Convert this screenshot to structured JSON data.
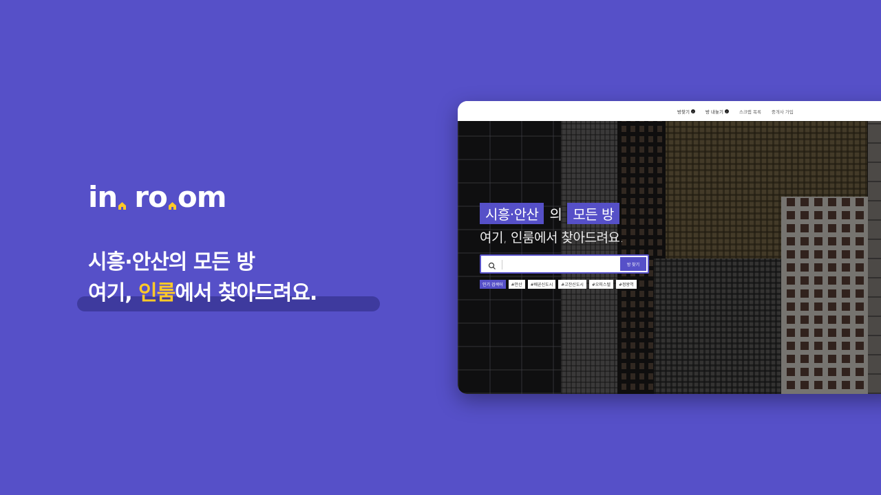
{
  "brand": {
    "logo_part1": "in",
    "logo_part2": "ro",
    "logo_part3": "om",
    "headline_line1": "시흥·안산의 모든 방",
    "headline_line2_pre": "여기, ",
    "headline_line2_accent": "인룸",
    "headline_line2_post": "에서 찾아드려요."
  },
  "colors": {
    "background": "#5650c8",
    "accent": "#ffc928",
    "highlight_bar": "#3e3a9e"
  },
  "nav": {
    "items": [
      {
        "label": "방찾기",
        "icon": "arrow-right-circle-icon"
      },
      {
        "label": "방 내놓기",
        "icon": "arrow-right-circle-icon"
      },
      {
        "label": "스크랩 목록"
      },
      {
        "label": "중개사 가입"
      }
    ]
  },
  "hero": {
    "title_tag1": "시흥·안산",
    "title_mid": "의",
    "title_tag2": "모든 방",
    "subtitle": "여기, 인룸에서 찾아드려요.",
    "search": {
      "placeholder": "",
      "value": "",
      "button_label": "방 찾기",
      "icon": "search-icon"
    },
    "popular_label": "인기 검색어",
    "tags": [
      "#안산",
      "#배곧신도시",
      "#고잔신도시",
      "#오피스텔",
      "#정왕역"
    ]
  }
}
